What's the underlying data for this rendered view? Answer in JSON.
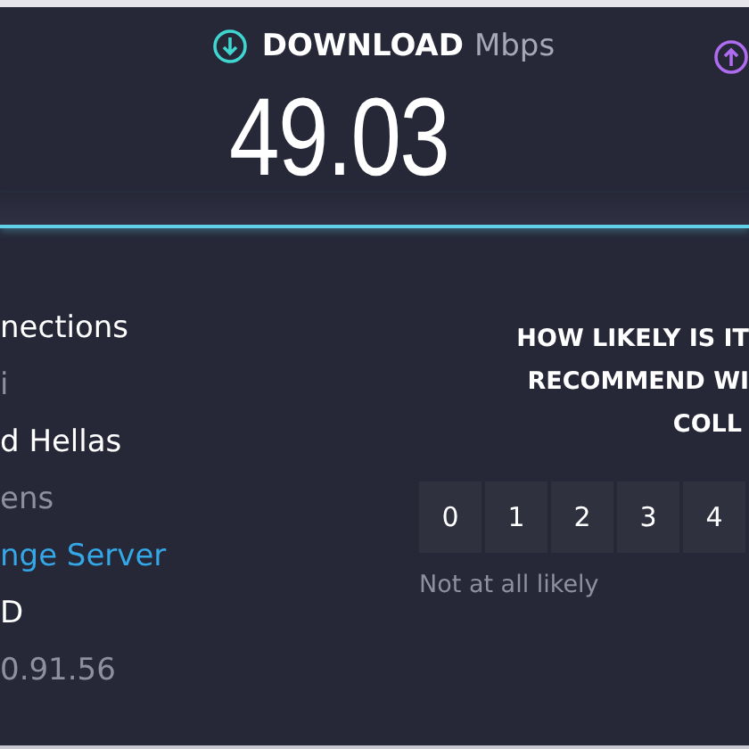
{
  "header": {
    "download_label": "DOWNLOAD",
    "unit": "Mbps",
    "value": "49.03"
  },
  "connection_info": [
    {
      "kind": "title",
      "text": "nections"
    },
    {
      "kind": "sub",
      "text": "i"
    },
    {
      "kind": "title",
      "text": "d Hellas"
    },
    {
      "kind": "sub",
      "text": "ens"
    },
    {
      "kind": "link",
      "text": "nge Server"
    },
    {
      "kind": "title",
      "text": "D"
    },
    {
      "kind": "sub",
      "text": "0.91.56"
    }
  ],
  "survey": {
    "question_lines": [
      "HOW LIKELY IS IT",
      "RECOMMEND WI",
      "COLL"
    ],
    "scores": [
      "0",
      "1",
      "2",
      "3",
      "4"
    ],
    "low_label": "Not at all likely"
  }
}
